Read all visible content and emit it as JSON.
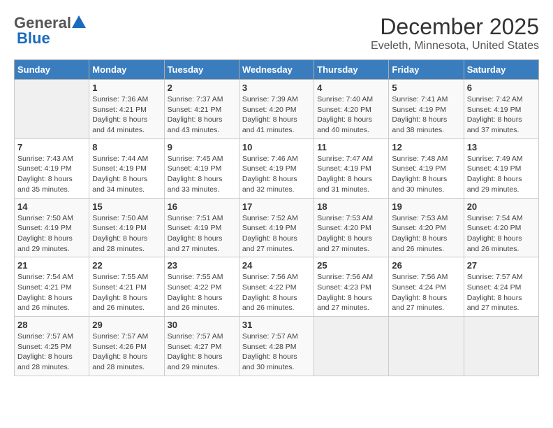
{
  "header": {
    "logo_general": "General",
    "logo_blue": "Blue",
    "title": "December 2025",
    "subtitle": "Eveleth, Minnesota, United States"
  },
  "calendar": {
    "days_of_week": [
      "Sunday",
      "Monday",
      "Tuesday",
      "Wednesday",
      "Thursday",
      "Friday",
      "Saturday"
    ],
    "weeks": [
      [
        {
          "day": "",
          "info": ""
        },
        {
          "day": "1",
          "info": "Sunrise: 7:36 AM\nSunset: 4:21 PM\nDaylight: 8 hours\nand 44 minutes."
        },
        {
          "day": "2",
          "info": "Sunrise: 7:37 AM\nSunset: 4:21 PM\nDaylight: 8 hours\nand 43 minutes."
        },
        {
          "day": "3",
          "info": "Sunrise: 7:39 AM\nSunset: 4:20 PM\nDaylight: 8 hours\nand 41 minutes."
        },
        {
          "day": "4",
          "info": "Sunrise: 7:40 AM\nSunset: 4:20 PM\nDaylight: 8 hours\nand 40 minutes."
        },
        {
          "day": "5",
          "info": "Sunrise: 7:41 AM\nSunset: 4:19 PM\nDaylight: 8 hours\nand 38 minutes."
        },
        {
          "day": "6",
          "info": "Sunrise: 7:42 AM\nSunset: 4:19 PM\nDaylight: 8 hours\nand 37 minutes."
        }
      ],
      [
        {
          "day": "7",
          "info": "Sunrise: 7:43 AM\nSunset: 4:19 PM\nDaylight: 8 hours\nand 35 minutes."
        },
        {
          "day": "8",
          "info": "Sunrise: 7:44 AM\nSunset: 4:19 PM\nDaylight: 8 hours\nand 34 minutes."
        },
        {
          "day": "9",
          "info": "Sunrise: 7:45 AM\nSunset: 4:19 PM\nDaylight: 8 hours\nand 33 minutes."
        },
        {
          "day": "10",
          "info": "Sunrise: 7:46 AM\nSunset: 4:19 PM\nDaylight: 8 hours\nand 32 minutes."
        },
        {
          "day": "11",
          "info": "Sunrise: 7:47 AM\nSunset: 4:19 PM\nDaylight: 8 hours\nand 31 minutes."
        },
        {
          "day": "12",
          "info": "Sunrise: 7:48 AM\nSunset: 4:19 PM\nDaylight: 8 hours\nand 30 minutes."
        },
        {
          "day": "13",
          "info": "Sunrise: 7:49 AM\nSunset: 4:19 PM\nDaylight: 8 hours\nand 29 minutes."
        }
      ],
      [
        {
          "day": "14",
          "info": "Sunrise: 7:50 AM\nSunset: 4:19 PM\nDaylight: 8 hours\nand 29 minutes."
        },
        {
          "day": "15",
          "info": "Sunrise: 7:50 AM\nSunset: 4:19 PM\nDaylight: 8 hours\nand 28 minutes."
        },
        {
          "day": "16",
          "info": "Sunrise: 7:51 AM\nSunset: 4:19 PM\nDaylight: 8 hours\nand 27 minutes."
        },
        {
          "day": "17",
          "info": "Sunrise: 7:52 AM\nSunset: 4:19 PM\nDaylight: 8 hours\nand 27 minutes."
        },
        {
          "day": "18",
          "info": "Sunrise: 7:53 AM\nSunset: 4:20 PM\nDaylight: 8 hours\nand 27 minutes."
        },
        {
          "day": "19",
          "info": "Sunrise: 7:53 AM\nSunset: 4:20 PM\nDaylight: 8 hours\nand 26 minutes."
        },
        {
          "day": "20",
          "info": "Sunrise: 7:54 AM\nSunset: 4:20 PM\nDaylight: 8 hours\nand 26 minutes."
        }
      ],
      [
        {
          "day": "21",
          "info": "Sunrise: 7:54 AM\nSunset: 4:21 PM\nDaylight: 8 hours\nand 26 minutes."
        },
        {
          "day": "22",
          "info": "Sunrise: 7:55 AM\nSunset: 4:21 PM\nDaylight: 8 hours\nand 26 minutes."
        },
        {
          "day": "23",
          "info": "Sunrise: 7:55 AM\nSunset: 4:22 PM\nDaylight: 8 hours\nand 26 minutes."
        },
        {
          "day": "24",
          "info": "Sunrise: 7:56 AM\nSunset: 4:22 PM\nDaylight: 8 hours\nand 26 minutes."
        },
        {
          "day": "25",
          "info": "Sunrise: 7:56 AM\nSunset: 4:23 PM\nDaylight: 8 hours\nand 27 minutes."
        },
        {
          "day": "26",
          "info": "Sunrise: 7:56 AM\nSunset: 4:24 PM\nDaylight: 8 hours\nand 27 minutes."
        },
        {
          "day": "27",
          "info": "Sunrise: 7:57 AM\nSunset: 4:24 PM\nDaylight: 8 hours\nand 27 minutes."
        }
      ],
      [
        {
          "day": "28",
          "info": "Sunrise: 7:57 AM\nSunset: 4:25 PM\nDaylight: 8 hours\nand 28 minutes."
        },
        {
          "day": "29",
          "info": "Sunrise: 7:57 AM\nSunset: 4:26 PM\nDaylight: 8 hours\nand 28 minutes."
        },
        {
          "day": "30",
          "info": "Sunrise: 7:57 AM\nSunset: 4:27 PM\nDaylight: 8 hours\nand 29 minutes."
        },
        {
          "day": "31",
          "info": "Sunrise: 7:57 AM\nSunset: 4:28 PM\nDaylight: 8 hours\nand 30 minutes."
        },
        {
          "day": "",
          "info": ""
        },
        {
          "day": "",
          "info": ""
        },
        {
          "day": "",
          "info": ""
        }
      ]
    ]
  }
}
